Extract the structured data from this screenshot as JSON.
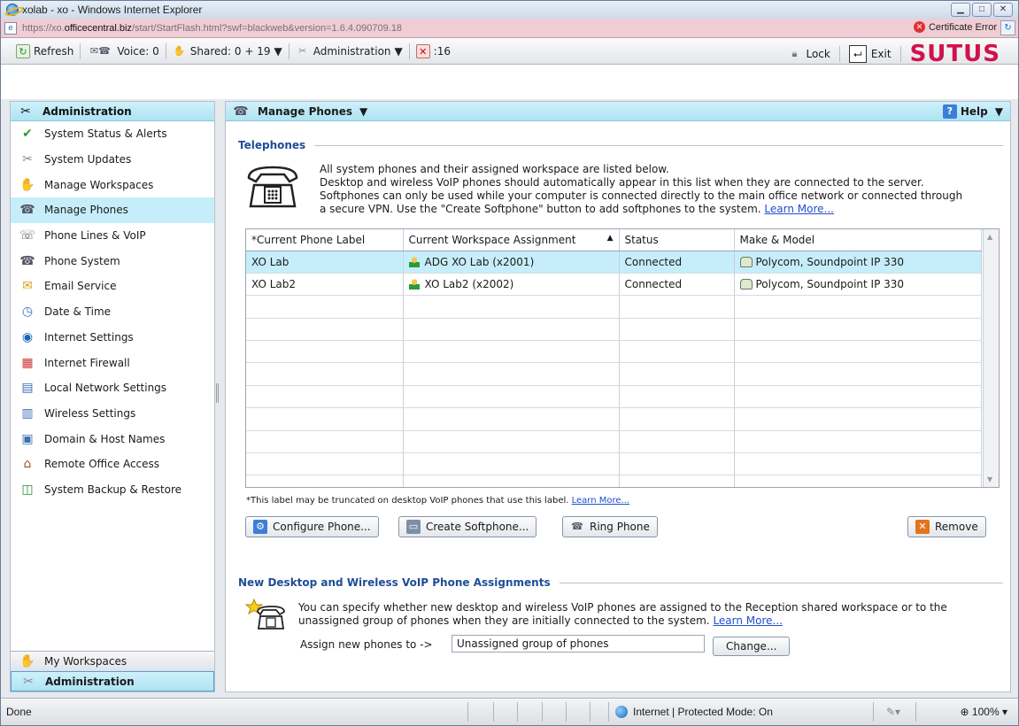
{
  "window": {
    "title": "xolab - xo - Windows Internet Explorer",
    "url_prefix": "https://xo.",
    "url_domain": "officecentral.biz",
    "url_rest": "/start/StartFlash.html?swf=blackweb&version=1.6.4.090709.18",
    "cert_error": "Certificate Error"
  },
  "toolbar": {
    "refresh": "Refresh",
    "voice": "Voice: 0",
    "shared": "Shared: 0 + 19",
    "administration": "Administration",
    "alert_count": ":16",
    "lock": "Lock",
    "exit": "Exit",
    "brand": "SUTUS"
  },
  "sidebar": {
    "header": "Administration",
    "items": [
      {
        "label": "System Status & Alerts"
      },
      {
        "label": "System Updates"
      },
      {
        "label": "Manage Workspaces"
      },
      {
        "label": "Manage Phones"
      },
      {
        "label": "Phone Lines & VoIP"
      },
      {
        "label": "Phone System"
      },
      {
        "label": "Email Service"
      },
      {
        "label": "Date & Time"
      },
      {
        "label": "Internet Settings"
      },
      {
        "label": "Internet Firewall"
      },
      {
        "label": "Local Network Settings"
      },
      {
        "label": "Wireless Settings"
      },
      {
        "label": "Domain & Host Names"
      },
      {
        "label": "Remote Office Access"
      },
      {
        "label": "System Backup & Restore"
      }
    ],
    "bottom_workspaces": "My Workspaces",
    "bottom_admin": "Administration"
  },
  "panel": {
    "title": "Manage Phones",
    "help": "Help"
  },
  "telephones": {
    "section_title": "Telephones",
    "desc_line1": "All system phones and their assigned workspace are listed below.",
    "desc_line2": "Desktop and wireless VoIP phones should automatically appear in this list when they are connected to the server.",
    "desc_line3": "Softphones can only be used while your computer is connected directly to the main office network or connected through",
    "desc_line4": "a secure VPN. Use the \"Create Softphone\" button to add softphones to the system.",
    "learn_more": "Learn More...",
    "columns": [
      "*Current Phone Label",
      "Current Workspace Assignment",
      "Status",
      "Make & Model"
    ],
    "sort_indicator": "▲",
    "rows": [
      {
        "label": "XO Lab",
        "workspace": "ADG XO Lab (x2001)",
        "status": "Connected",
        "model": "Polycom, Soundpoint IP 330"
      },
      {
        "label": "XO Lab2",
        "workspace": "XO Lab2 (x2002)",
        "status": "Connected",
        "model": "Polycom, Soundpoint IP 330"
      }
    ],
    "footnote": "*This label may be truncated on desktop VoIP phones that use this label.",
    "footnote_link": "Learn More...",
    "buttons": {
      "configure": "Configure Phone...",
      "create": "Create Softphone...",
      "ring": "Ring Phone",
      "remove": "Remove"
    }
  },
  "assignments": {
    "section_title": "New Desktop and Wireless VoIP Phone Assignments",
    "desc_line1": "You can specify whether new desktop and wireless VoIP phones are assigned to the Reception shared workspace or to the",
    "desc_line2": "unassigned group of phones when they are initially connected to the system.",
    "learn_more": "Learn More...",
    "assign_label": "Assign new phones to ->",
    "assign_value": "Unassigned group of phones",
    "change_button": "Change..."
  },
  "statusbar": {
    "done": "Done",
    "zone": "Internet | Protected Mode: On",
    "zoom": "100%"
  }
}
